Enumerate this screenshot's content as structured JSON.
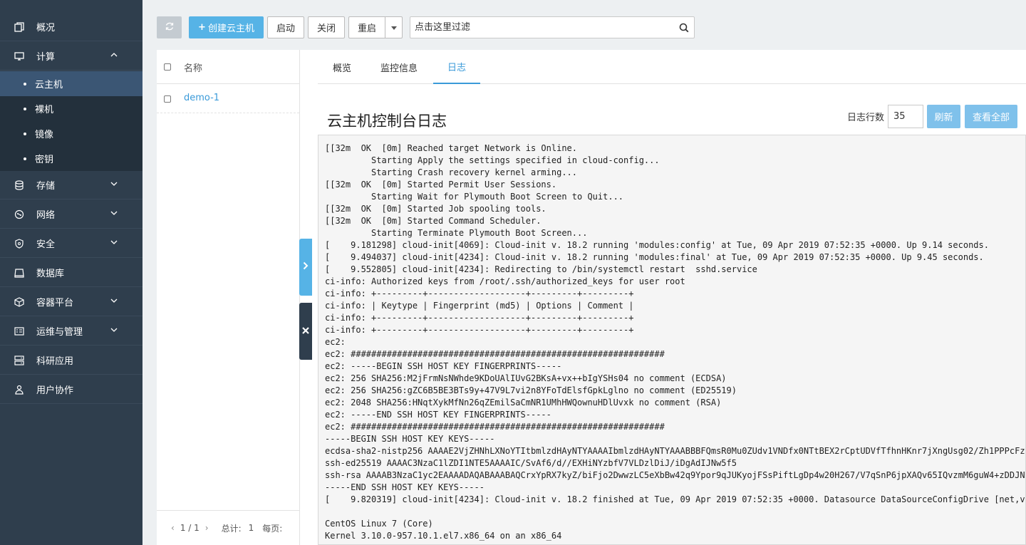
{
  "sidebar": {
    "items": [
      {
        "label": "概况",
        "icon": "copy-icon"
      },
      {
        "label": "计算",
        "icon": "monitor-icon",
        "expanded": true
      },
      {
        "label": "存储",
        "icon": "database-icon"
      },
      {
        "label": "网络",
        "icon": "network-icon"
      },
      {
        "label": "安全",
        "icon": "shield-icon"
      },
      {
        "label": "数据库",
        "icon": "server-icon"
      },
      {
        "label": "容器平台",
        "icon": "box-icon"
      },
      {
        "label": "运维与管理",
        "icon": "list-icon"
      },
      {
        "label": "科研应用",
        "icon": "server-stack-icon"
      },
      {
        "label": "用户协作",
        "icon": "users-icon"
      }
    ],
    "subitems": [
      {
        "label": "云主机",
        "active": true
      },
      {
        "label": "裸机"
      },
      {
        "label": "镜像"
      },
      {
        "label": "密钥"
      }
    ]
  },
  "toolbar": {
    "create_label": "创建云主机",
    "start_label": "启动",
    "stop_label": "关闭",
    "reboot_label": "重启",
    "search_placeholder": "点击这里过滤"
  },
  "list": {
    "header_name": "名称",
    "rows": [
      {
        "name": "demo-1"
      }
    ],
    "footer": {
      "pagination": "1 / 1",
      "total_label": "总计:",
      "total_value": "1",
      "per_page_label": "每页:"
    }
  },
  "detail": {
    "tabs": [
      {
        "label": "概览"
      },
      {
        "label": "监控信息"
      },
      {
        "label": "日志",
        "active": true
      }
    ],
    "title": "云主机控制台日志",
    "lines_label": "日志行数",
    "lines_value": "35",
    "refresh_label": "刷新",
    "view_all_label": "查看全部",
    "log_text": "[[32m  OK  [0m] Reached target Network is Online.\n         Starting Apply the settings specified in cloud-config...\n         Starting Crash recovery kernel arming...\n[[32m  OK  [0m] Started Permit User Sessions.\n         Starting Wait for Plymouth Boot Screen to Quit...\n[[32m  OK  [0m] Started Job spooling tools.\n[[32m  OK  [0m] Started Command Scheduler.\n         Starting Terminate Plymouth Boot Screen...\n[    9.181298] cloud-init[4069]: Cloud-init v. 18.2 running 'modules:config' at Tue, 09 Apr 2019 07:52:35 +0000. Up 9.14 seconds.\n[    9.494037] cloud-init[4234]: Cloud-init v. 18.2 running 'modules:final' at Tue, 09 Apr 2019 07:52:35 +0000. Up 9.45 seconds.\n[    9.552805] cloud-init[4234]: Redirecting to /bin/systemctl restart  sshd.service\nci-info: Authorized keys from /root/.ssh/authorized_keys for user root\nci-info: +---------+-------------------+---------+---------+\nci-info: | Keytype | Fingerprint (md5) | Options | Comment |\nci-info: +---------+-------------------+---------+---------+\nci-info: +---------+-------------------+---------+---------+\nec2:\nec2: #############################################################\nec2: -----BEGIN SSH HOST KEY FINGERPRINTS-----\nec2: 256 SHA256:M2jFrmNsNWhde9KDoUAlIUvG2BKsA+vx++bIgYSHs04 no comment (ECDSA)\nec2: 256 SHA256:gZC6B5BE3BTs9y+47V9L7vi2n8YFoTdElsfGpkLglno no comment (ED25519)\nec2: 2048 SHA256:HNqtXykMfNn26qZEmilSaCmNR1UMhHWQownuHDlUvxk no comment (RSA)\nec2: -----END SSH HOST KEY FINGERPRINTS-----\nec2: #############################################################\n-----BEGIN SSH HOST KEY KEYS-----\necdsa-sha2-nistp256 AAAAE2VjZHNhLXNoYTItbmlzdHAyNTYAAAAIbmlzdHAyNTYAAABBBFQmsR0Mu0ZUdv1VNDfx0NTtBEX2rCptUDVfTfhnHKnr7jXngUsg02/Zh1PPPcFz\nssh-ed25519 AAAAC3NzaC1lZDI1NTE5AAAAIC/SvAf6/d//EXHiNYzbfV7VLDzlDiJ/iDgAdIJNw5f5\nssh-rsa AAAAB3NzaC1yc2EAAAADAQABAAABAQCrxYpRX7kyZ/biFjo2DwwzLC5eXbBw42q9Ypor9qJUKyojFSsPiftLgDp4w20H267/V7qSnP6jpXAQv65IQvzmM6guW4+zDDJN\n-----END SSH HOST KEY KEYS-----\n[    9.820319] cloud-init[4234]: Cloud-init v. 18.2 finished at Tue, 09 Apr 2019 07:52:35 +0000. Datasource DataSourceConfigDrive [net,v\n\nCentOS Linux 7 (Core)\nKernel 3.10.0-957.10.1.el7.x86_64 on an x86_64"
  }
}
